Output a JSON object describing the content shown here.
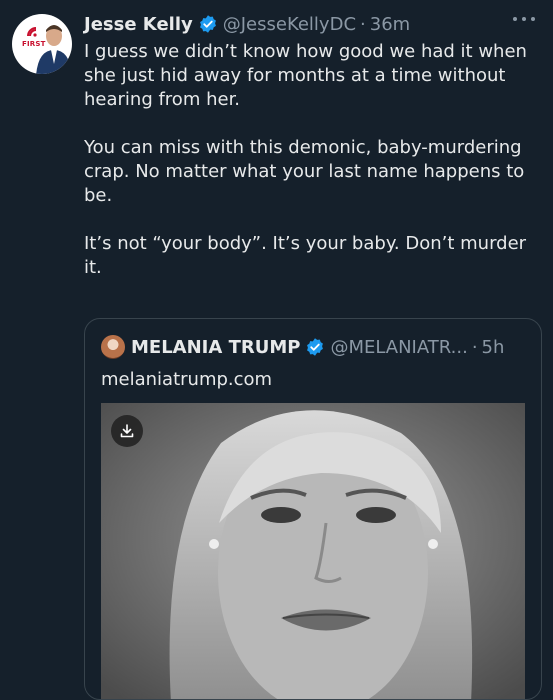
{
  "tweet": {
    "author_name": "Jesse Kelly",
    "handle": "@JesseKellyDC",
    "separator": "·",
    "time": "36m",
    "avatar_brand": "FIRST",
    "paragraphs": [
      "I guess we didn’t know how good we had it when she just hid away for months at a time without hearing from her.",
      "You can miss with this demonic, baby-murdering crap. No matter what your last name happens to be.",
      "It’s not “your body”. It’s your baby. Don’t murder it."
    ]
  },
  "quoted_tweet": {
    "author_name": "MELANIA TRUMP",
    "handle": "@MELANIATR...",
    "separator": "·",
    "time": "5h",
    "link_text": "melaniatrump.com"
  },
  "icons": {
    "verified": "verified-badge-icon",
    "more": "more-options-icon",
    "download": "download-icon"
  },
  "colors": {
    "background": "#15202b",
    "text": "#e7e9ea",
    "muted": "#8b98a5",
    "verified": "#1d9bf0",
    "border": "#38444d"
  }
}
